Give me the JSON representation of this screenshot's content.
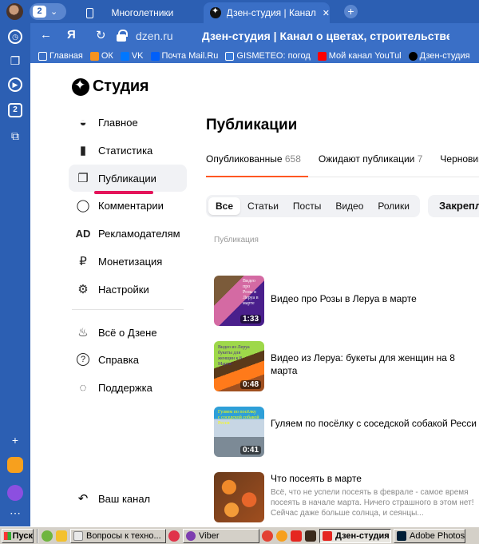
{
  "browser": {
    "tab_count": "2",
    "tabs": [
      {
        "title": "Многолетники"
      },
      {
        "title": "Дзен-студия | Канал о цветах"
      }
    ],
    "url": "dzen.ru",
    "page_title": "Дзен-студия | Канал о цветах, строительстве дома и д",
    "bookmarks": [
      {
        "label": "Главная",
        "color": "#ffffff"
      },
      {
        "label": "ОК",
        "color": "#f7931e"
      },
      {
        "label": "VK",
        "color": "#0077ff"
      },
      {
        "label": "Почта Mail.Ru",
        "color": "#005ff9"
      },
      {
        "label": "GISMETEO: погод",
        "color": "#3b7bd8"
      },
      {
        "label": "Мой канал YouTul",
        "color": "#ff0000"
      },
      {
        "label": "Дзен-студия",
        "color": "#000000"
      }
    ],
    "sidebar_badge": "2"
  },
  "studio": {
    "logo": "Студия",
    "menu": [
      {
        "label": "Главное",
        "icon": "planet-icon",
        "glyph": "◒"
      },
      {
        "label": "Статистика",
        "icon": "stats-icon",
        "glyph": "▮"
      },
      {
        "label": "Публикации",
        "icon": "publications-icon",
        "glyph": "❐"
      },
      {
        "label": "Комментарии",
        "icon": "comment-icon",
        "glyph": "◯"
      },
      {
        "label": "Рекламодателям",
        "icon": "ad-icon",
        "glyph": "AD"
      },
      {
        "label": "Монетизация",
        "icon": "ruble-icon",
        "glyph": "₽"
      },
      {
        "label": "Настройки",
        "icon": "gear-icon",
        "glyph": "⚙"
      },
      {
        "label": "Всё о Дзене",
        "icon": "fire-icon",
        "glyph": "♨"
      },
      {
        "label": "Справка",
        "icon": "help-icon",
        "glyph": "?"
      },
      {
        "label": "Поддержка",
        "icon": "support-icon",
        "glyph": "◌"
      }
    ],
    "channel_label": "Ваш канал"
  },
  "main": {
    "title": "Публикации",
    "tabs": [
      {
        "label": "Опубликованные",
        "count": "658"
      },
      {
        "label": "Ожидают публикации",
        "count": "7"
      },
      {
        "label": "Черновики",
        "count": ""
      }
    ],
    "filters": [
      "Все",
      "Статьи",
      "Посты",
      "Видео",
      "Ролики"
    ],
    "pinned_label": "Закрепленные",
    "column_header": "Публикация",
    "publications": [
      {
        "title": "Видео про Розы в Леруа в марте",
        "duration": "1:33",
        "thumb_text": "Видео про Розы в Леруа в марте",
        "description": ""
      },
      {
        "title": "Видео из Леруа: букеты для женщин на 8 марта",
        "duration": "0:48",
        "thumb_text": "Видео из Леруа букеты для женщин к 8 Марта!",
        "description": ""
      },
      {
        "title": "Гуляем по посёлку с соседской собакой Ресси",
        "duration": "0:41",
        "thumb_text": "Гуляем по посёлку с соседской собакой Ресси",
        "description": ""
      },
      {
        "title": "Что посеять в марте",
        "duration": "",
        "thumb_text": "",
        "description": "Всё, что не успели посеять в феврале - самое время посеять в начале марта. Ничего страшного в этом нет! Сейчас даже больше солнца, и сеянцы..."
      }
    ]
  },
  "taskbar": {
    "start": "Пуск",
    "items": [
      {
        "label": "Вопросы к техно...",
        "color": "#e9e9e9"
      },
      {
        "label": "Viber",
        "color": "#7d3daf"
      },
      {
        "label": "Дзен-студия | ...",
        "color": "#e52620"
      },
      {
        "label": "Adobe Photosh...",
        "color": "#001e36"
      }
    ]
  },
  "colors": {
    "browser_chrome": "#2c5fb3",
    "accent_underline": "#e4145a",
    "active_tab_bar": "#ff5722",
    "menu_active_bg": "#f1f2f5"
  }
}
